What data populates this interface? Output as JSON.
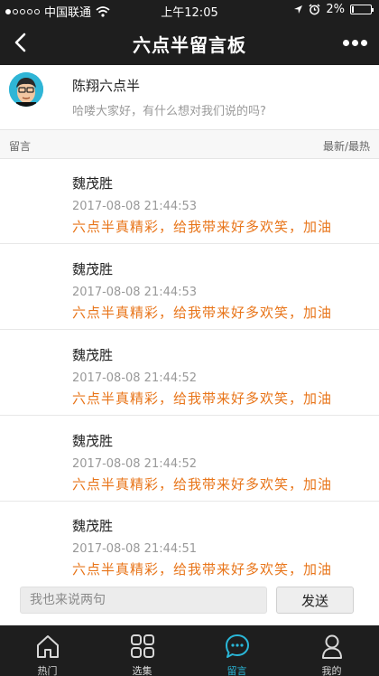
{
  "status_bar": {
    "carrier": "中国联通",
    "time": "上午12:05",
    "battery": "2%",
    "battery_level": 0.02
  },
  "nav": {
    "title": "六点半留言板"
  },
  "profile": {
    "name": "陈翔六点半",
    "description": "哈喽大家好，有什么想对我们说的吗?"
  },
  "list_header": {
    "left": "留言",
    "right": "最新/最热"
  },
  "messages": [
    {
      "author": "魏茂胜",
      "time": "2017-08-08 21:44:53",
      "text": "六点半真精彩，给我带来好多欢笑，加油"
    },
    {
      "author": "魏茂胜",
      "time": "2017-08-08 21:44:53",
      "text": "六点半真精彩，给我带来好多欢笑，加油"
    },
    {
      "author": "魏茂胜",
      "time": "2017-08-08 21:44:52",
      "text": "六点半真精彩，给我带来好多欢笑，加油"
    },
    {
      "author": "魏茂胜",
      "time": "2017-08-08 21:44:52",
      "text": "六点半真精彩，给我带来好多欢笑，加油"
    },
    {
      "author": "魏茂胜",
      "time": "2017-08-08 21:44:51",
      "text": "六点半真精彩，给我带来好多欢笑，加油"
    }
  ],
  "input": {
    "placeholder": "我也来说两句",
    "value": "",
    "send_label": "发送"
  },
  "tabs": [
    {
      "label": "热门",
      "icon": "home-icon",
      "active": false
    },
    {
      "label": "选集",
      "icon": "grid-icon",
      "active": false
    },
    {
      "label": "留言",
      "icon": "chat-bubble-icon",
      "active": true
    },
    {
      "label": "我的",
      "icon": "person-icon",
      "active": false
    }
  ],
  "colors": {
    "bar_background": "#1e1e1e",
    "accent": "#2ab7d8",
    "message_text": "#e8751a"
  }
}
